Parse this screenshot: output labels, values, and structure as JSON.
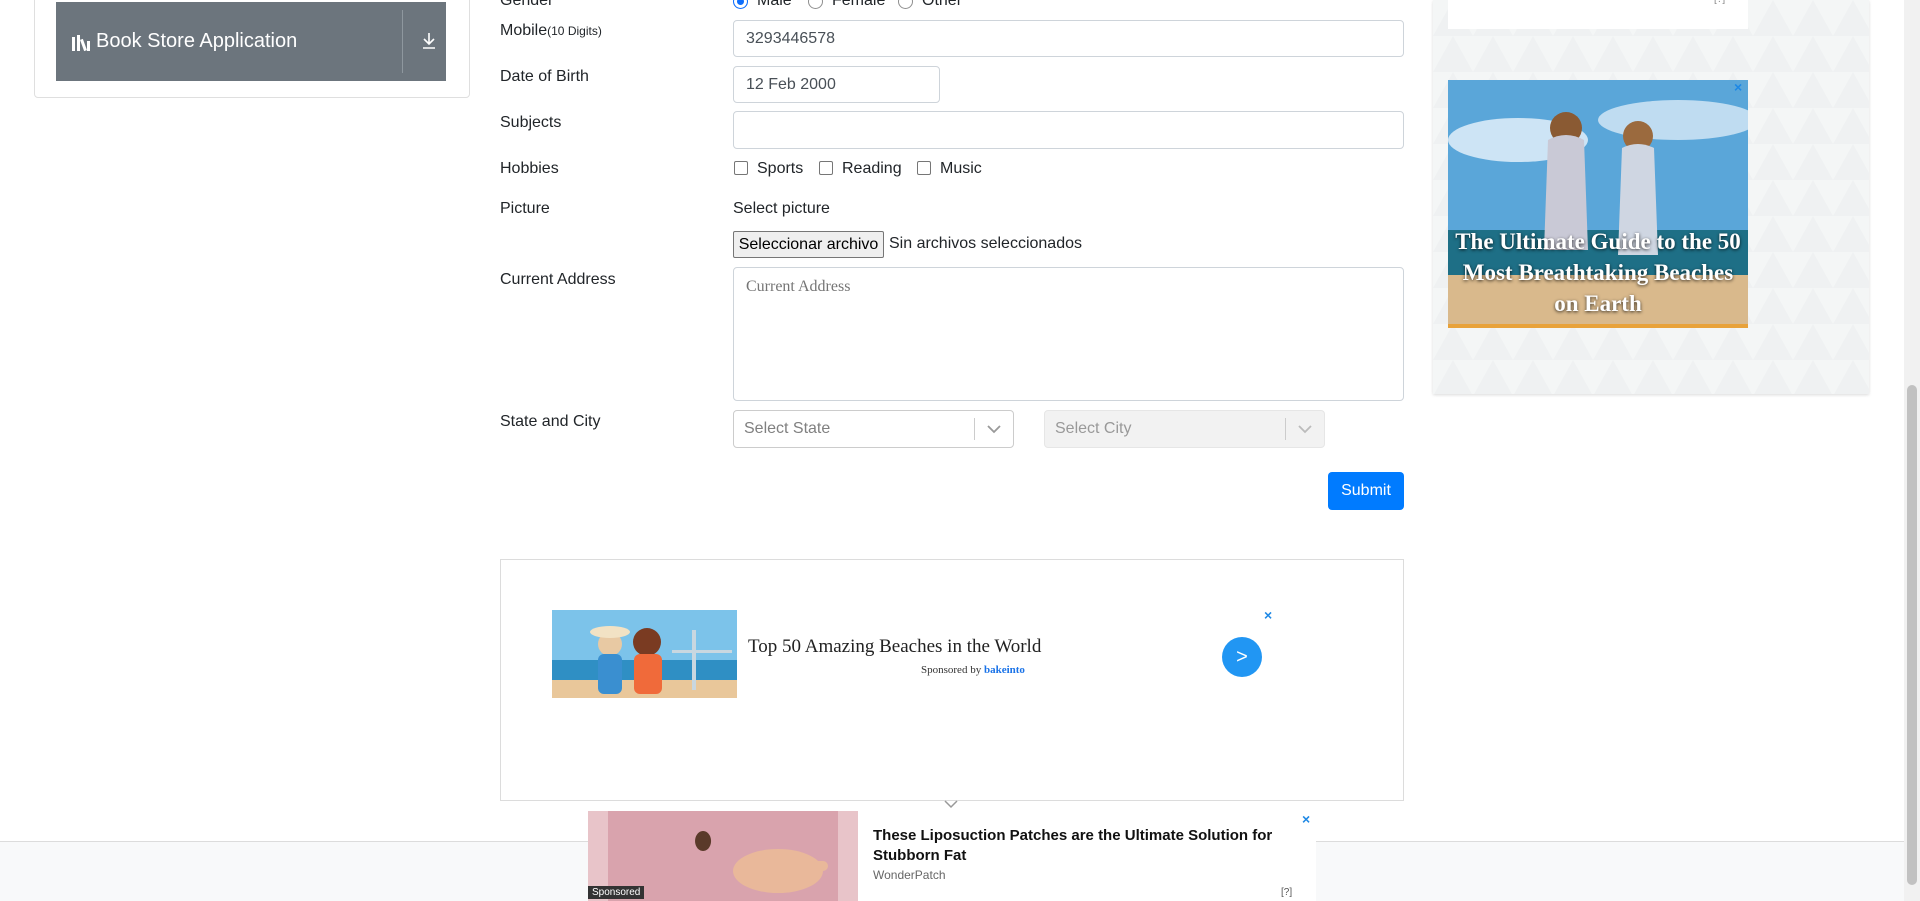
{
  "sidebar": {
    "book_store_label": "Book Store Application"
  },
  "form": {
    "gender": {
      "label": "Gender",
      "options": [
        "Male",
        "Female",
        "Other"
      ],
      "selected": "Male"
    },
    "mobile": {
      "label": "Mobile",
      "label_hint": "(10 Digits)",
      "value": "3293446578"
    },
    "dob": {
      "label": "Date of Birth",
      "value": "12 Feb 2000"
    },
    "subjects": {
      "label": "Subjects",
      "value": ""
    },
    "hobbies": {
      "label": "Hobbies",
      "options": [
        "Sports",
        "Reading",
        "Music"
      ]
    },
    "picture": {
      "label": "Picture",
      "prompt": "Select picture",
      "button": "Seleccionar archivo",
      "status": "Sin archivos seleccionados"
    },
    "address": {
      "label": "Current Address",
      "placeholder": "Current Address"
    },
    "state_city": {
      "label": "State and City",
      "state_placeholder": "Select State",
      "city_placeholder": "Select City"
    },
    "submit_label": "Submit"
  },
  "ads": {
    "bottom": {
      "title": "Top 50 Amazing Beaches in the World",
      "sponsored_prefix": "Sponsored by",
      "sponsor": "bakeinto",
      "go": ">",
      "close": "×"
    },
    "right": {
      "caption": "The Ultimate Guide to the 50 Most Breathtaking Beaches on Earth",
      "close": "×",
      "info": "[?]"
    },
    "sticky": {
      "title": "These Liposuction Patches are the Ultimate Solution for Stubborn Fat",
      "brand": "WonderPatch",
      "badge": "Sponsored",
      "close": "×",
      "info": "[?]"
    }
  },
  "colors": {
    "primary": "#007bff",
    "sidebar_button": "#6c757d",
    "ad_accent": "#2196f3"
  }
}
